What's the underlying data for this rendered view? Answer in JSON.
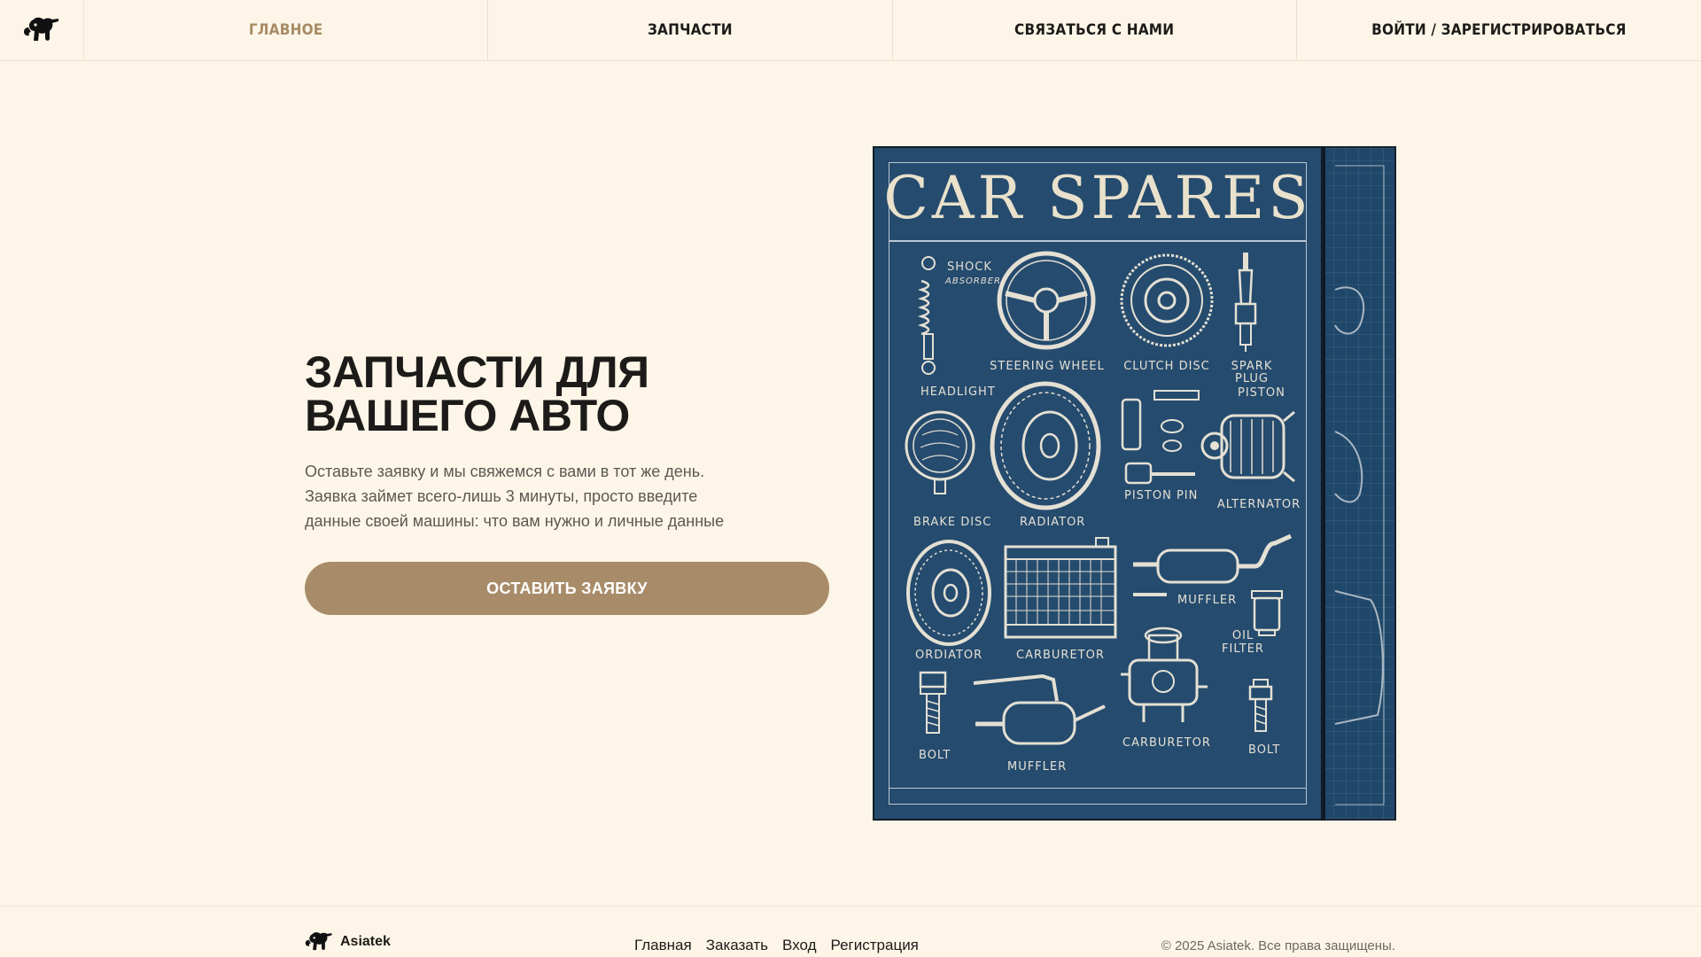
{
  "nav": {
    "logo_icon": "elephant-logo-icon",
    "items": [
      {
        "label": "ГЛАВНОЕ",
        "active": true
      },
      {
        "label": "ЗАПЧАСТИ",
        "active": false
      },
      {
        "label": "СВЯЗАТЬСЯ С НАМИ",
        "active": false
      },
      {
        "label": "ВОЙТИ / ЗАРЕГИСТРИРОВАТЬСЯ",
        "active": false
      }
    ]
  },
  "hero": {
    "title_lines": [
      "ЗАПЧАСТИ ДЛЯ",
      "ВАШЕГО АВТО"
    ],
    "description_lines": [
      "Оставьте заявку и мы свяжемся с вами в тот же день.",
      "Заявка займет всего-лишь 3 минуты, просто введите",
      "данные своей машины: что вам нужно и личные данные"
    ],
    "cta_label": "ОСТАВИТЬ ЗАЯВКУ"
  },
  "poster": {
    "title": "CAR SPARES",
    "labels": {
      "shock": "SHOCK",
      "absorber": "ABSORBER",
      "steering_wheel": "STEERING WHEEL",
      "clutch_disc": "CLUTCH DISC",
      "spark_plug": "SPARK PLUG",
      "headlight": "HEADLIGHT",
      "piston": "PISTON",
      "piston_pin": "PISTON PIN",
      "alternator": "ALTERNATOR",
      "brake_disc": "BRAKE DISC",
      "radiator": "RADIATOR",
      "muffler_1": "MUFFLER",
      "oil": "OIL",
      "filter": "FILTER",
      "ordiator": "ORDIATOR",
      "carburetor_1": "CARBURETOR",
      "bolt_1": "BOLT",
      "muffler_2": "MUFFLER",
      "carburetor_2": "CARBURETOR",
      "bolt_2": "BOLT"
    }
  },
  "footer": {
    "brand": "Asiatek",
    "links": [
      "Главная",
      "Заказать",
      "Вход",
      "Регистрация"
    ],
    "copyright": "© 2025 Asiatek. Все права защищены."
  },
  "colors": {
    "background": "#fdf6e8",
    "accent": "#a88b68",
    "text": "#1d1b19",
    "poster_blue": "#254b6e"
  }
}
